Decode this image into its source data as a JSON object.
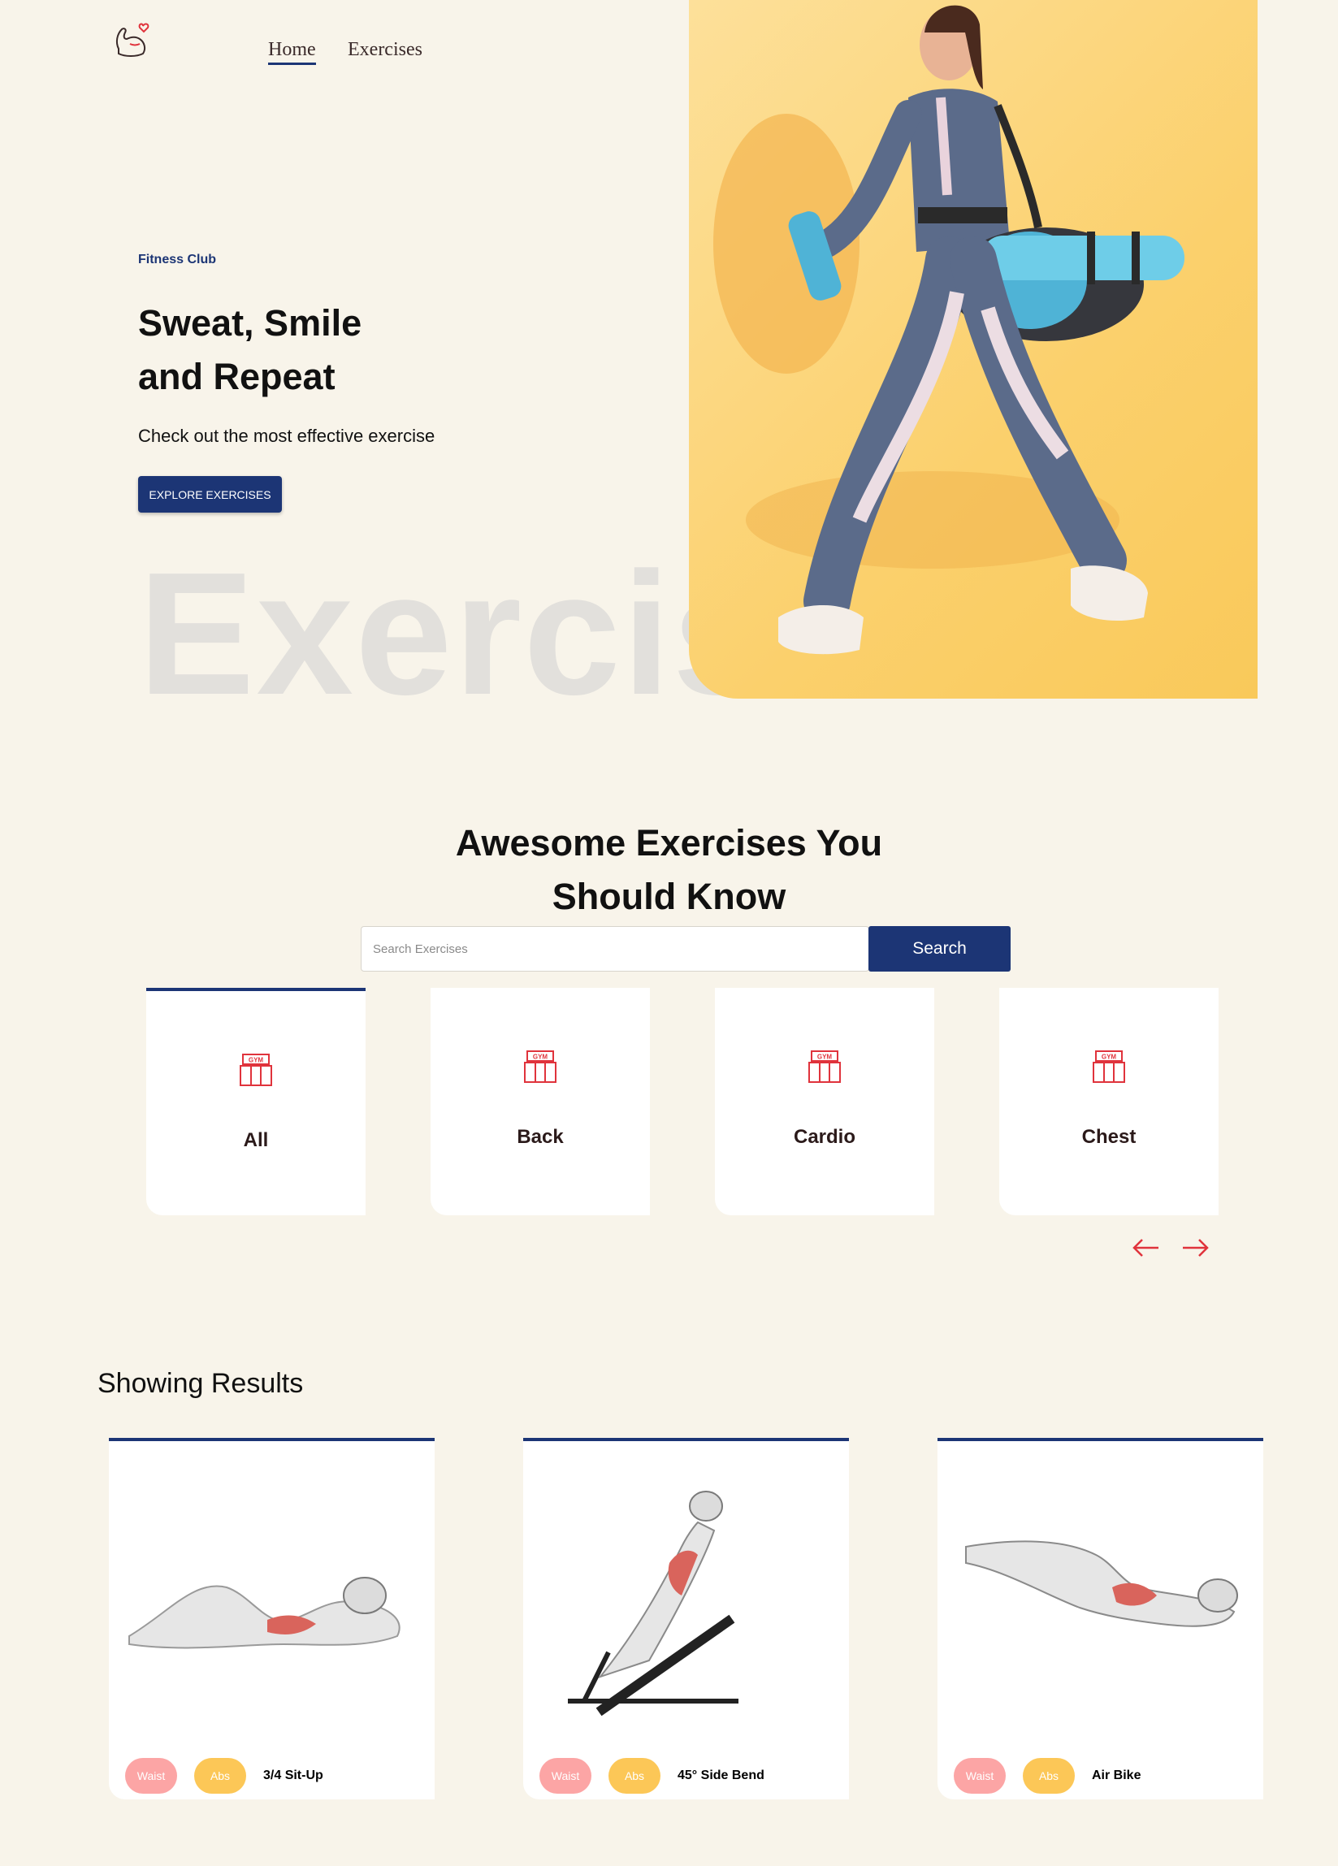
{
  "nav": {
    "home": "Home",
    "exercises": "Exercises"
  },
  "hero": {
    "eyebrow": "Fitness Club",
    "title_line1": "Sweat, Smile",
    "title_line2": "and Repeat",
    "subtitle": "Check out the most effective exercise",
    "cta": "EXPLORE EXERCISES",
    "background_word": "Exercis"
  },
  "search": {
    "title_line1": "Awesome Exercises You",
    "title_line2": "Should Know",
    "placeholder": "Search Exercises",
    "button": "Search"
  },
  "categories": {
    "icon_text": "GYM",
    "items": [
      {
        "label": "All",
        "active": true
      },
      {
        "label": "Back"
      },
      {
        "label": "Cardio"
      },
      {
        "label": "Chest"
      }
    ]
  },
  "results": {
    "title": "Showing Results",
    "cards": [
      {
        "tag1": "Waist",
        "tag2": "Abs",
        "name": "3/4 Sit-Up"
      },
      {
        "tag1": "Waist",
        "tag2": "Abs",
        "name": "45° Side Bend"
      },
      {
        "tag1": "Waist",
        "tag2": "Abs",
        "name": "Air Bike"
      }
    ]
  },
  "colors": {
    "primary": "#1c3575",
    "accent_red": "#e0333c",
    "tag_waist": "#fca5a5",
    "tag_abs": "#fcc757",
    "background": "#f8f4ea"
  }
}
